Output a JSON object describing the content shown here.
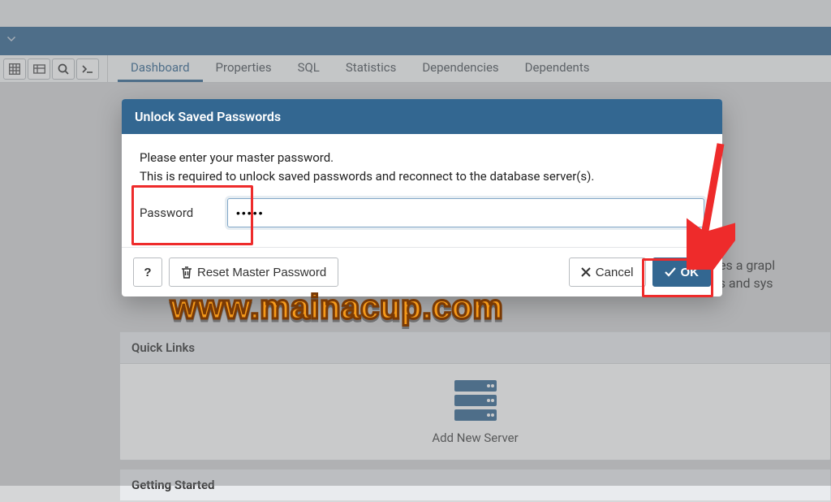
{
  "header": {
    "toolbar": {
      "grid_icon": "grid",
      "table_icon": "table",
      "search_icon": "search",
      "terminal_icon": "terminal"
    }
  },
  "tabs": {
    "dashboard": "Dashboard",
    "properties": "Properties",
    "sql": "SQL",
    "statistics": "Statistics",
    "dependencies": "Dependencies",
    "dependents": "Dependents"
  },
  "welcome": {
    "line1": "t includes a grapl",
    "line2": "rs, DBAs and sys"
  },
  "panels": {
    "quick_links": {
      "title": "Quick Links",
      "add_server": "Add New Server"
    },
    "getting_started": {
      "title": "Getting Started"
    }
  },
  "modal": {
    "title": "Unlock Saved Passwords",
    "message_line1": "Please enter your master password.",
    "message_line2": "This is required to unlock saved passwords and reconnect to the database server(s).",
    "password_label": "Password",
    "password_value": "•••••",
    "help_label": "?",
    "reset_label": "Reset Master Password",
    "cancel_label": "Cancel",
    "ok_label": "OK"
  },
  "watermark_text": "www.mainacup.com"
}
